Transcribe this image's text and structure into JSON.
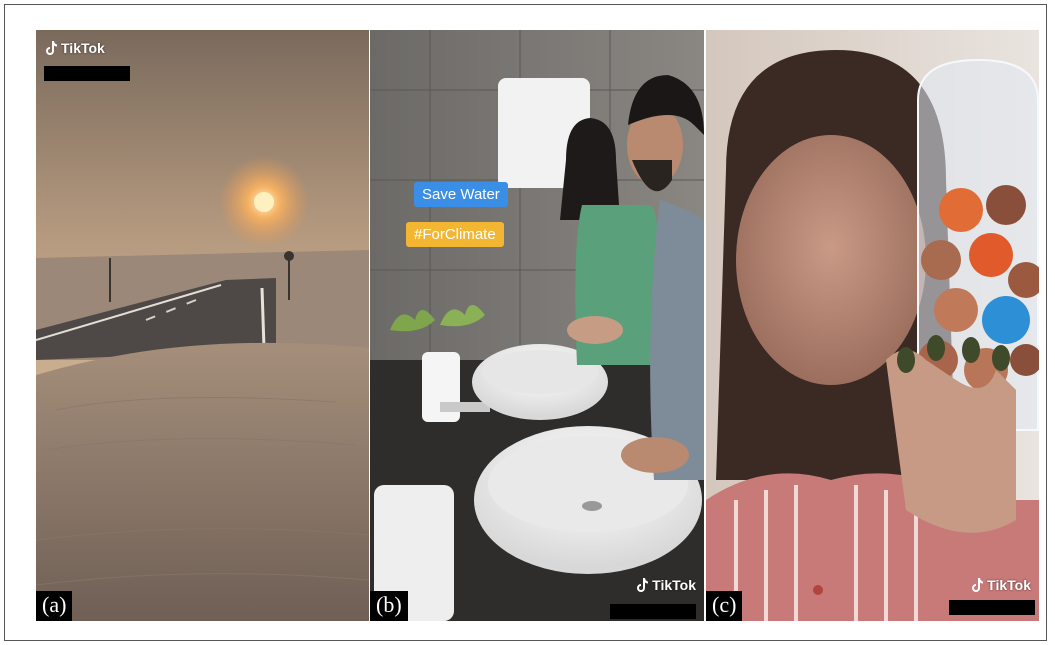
{
  "panels": [
    {
      "label": "(a)",
      "watermark": "TikTok"
    },
    {
      "label": "(b)",
      "watermark": "TikTok",
      "stickers": [
        "Save Water",
        "#ForClimate"
      ]
    },
    {
      "label": "(c)",
      "watermark": "TikTok"
    }
  ],
  "colors": {
    "sticker_blue": "#3a8ee6",
    "sticker_yellow": "#f2b632",
    "redaction": "#000000"
  }
}
